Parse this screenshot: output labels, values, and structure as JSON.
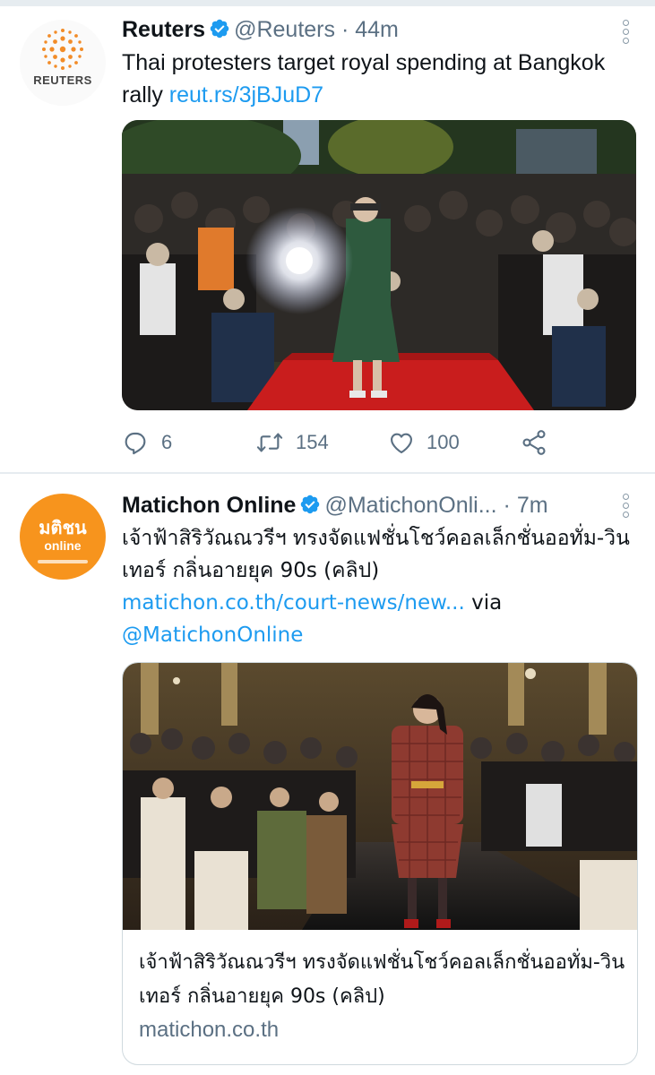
{
  "tweets": [
    {
      "name": "Reuters",
      "handle": "@Reuters",
      "separator": "·",
      "time": "44m",
      "avatar_label": "REUTERS",
      "text": "Thai protesters target royal spending at Bangkok rally",
      "link": "reut.rs/3jBJuD7",
      "counts": {
        "replies": "6",
        "retweets": "154",
        "likes": "100"
      }
    },
    {
      "name": "Matichon Online",
      "handle": "@MatichonOnli...",
      "separator": "·",
      "time": "7m",
      "avatar_label_top": "มติชน",
      "avatar_label_bottom": "online",
      "text": "เจ้าฟ้าสิริวัณณวรีฯ ทรงจัดแฟชั่นโชว์คอลเล็กชั่นออทั่ม-วินเทอร์ กลิ่นอายยุค 90s (คลิป)",
      "link": "matichon.co.th/court-news/new...",
      "via_word": "via",
      "via_handle": "@MatichonOnline",
      "card": {
        "title": "เจ้าฟ้าสิริวัณณวรีฯ ทรงจัดแฟชั่นโชว์คอลเล็กชั่นออทั่ม-วินเทอร์ กลิ่นอายยุค 90s (คลิป)",
        "domain": "matichon.co.th"
      }
    }
  ],
  "icons": {
    "verified": "verified-badge-icon",
    "reply": "reply-icon",
    "retweet": "retweet-icon",
    "like": "heart-icon",
    "share": "share-icon",
    "more": "more-vertical-icon"
  },
  "colors": {
    "link": "#1d9bf0",
    "secondary_text": "#5b7083",
    "reuters_orange": "#f28c28",
    "matichon_orange": "#f7941d",
    "carpet_red": "#c91d1d"
  }
}
